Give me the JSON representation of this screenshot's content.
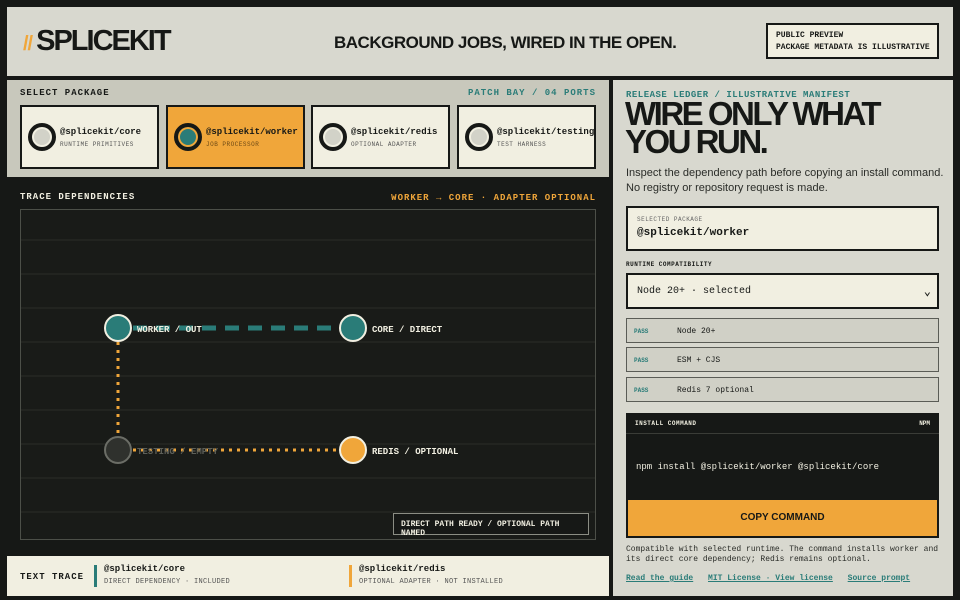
{
  "header": {
    "logo_slash": "//",
    "logo_text": "SPLICEKIT",
    "tagline": "BACKGROUND JOBS, WIRED IN THE OPEN.",
    "preview_line1": "PUBLIC PREVIEW",
    "preview_line2": "PACKAGE METADATA IS ILLUSTRATIVE"
  },
  "packages": {
    "label": "SELECT PACKAGE",
    "patch_label": "PATCH BAY / 04 PORTS",
    "items": [
      {
        "name": "@splicekit/core",
        "desc": "RUNTIME PRIMITIVES",
        "selected": false
      },
      {
        "name": "@splicekit/worker",
        "desc": "JOB PROCESSOR",
        "selected": true
      },
      {
        "name": "@splicekit/redis",
        "desc": "OPTIONAL ADAPTER",
        "selected": false
      },
      {
        "name": "@splicekit/testing",
        "desc": "TEST HARNESS",
        "selected": false
      }
    ]
  },
  "trace": {
    "title": "TRACE DEPENDENCIES",
    "path": "WORKER → CORE · ADAPTER OPTIONAL",
    "nodes": {
      "worker": "WORKER / OUT",
      "core": "CORE / DIRECT",
      "testing": "TESTING / EMPTY",
      "redis": "REDIS / OPTIONAL"
    },
    "status": "DIRECT PATH READY / OPTIONAL PATH NAMED"
  },
  "text_trace": {
    "label": "TEXT TRACE",
    "entries": [
      {
        "name": "@splicekit/core",
        "detail": "DIRECT DEPENDENCY · INCLUDED",
        "color": "#2a7c78"
      },
      {
        "name": "@splicekit/redis",
        "detail": "OPTIONAL ADAPTER · NOT INSTALLED",
        "color": "#f0a63a"
      }
    ]
  },
  "ledger": {
    "eyebrow": "RELEASE LEDGER / ILLUSTRATIVE MANIFEST",
    "headline": "WIRE ONLY WHAT YOU RUN.",
    "intro": "Inspect the dependency path before copying an install command. No registry or repository request is made.",
    "selected_label": "SELECTED PACKAGE",
    "selected_value": "@splicekit/worker",
    "runtime_label": "RUNTIME COMPATIBILITY",
    "runtime_value": "Node 20+ · selected",
    "checks": [
      {
        "status": "PASS",
        "text": "Node 20+"
      },
      {
        "status": "PASS",
        "text": "ESM + CJS"
      },
      {
        "status": "PASS",
        "text": "Redis 7 optional"
      }
    ],
    "install_title": "INSTALL COMMAND",
    "install_tool": "NPM",
    "install_cmd": "npm install @splicekit/worker @splicekit/core",
    "copy_label": "COPY COMMAND",
    "note": "Compatible with selected runtime. The command installs worker and its direct core dependency; Redis remains optional.",
    "links": [
      "Read the guide",
      "MIT License · View license",
      "Source prompt"
    ]
  },
  "colors": {
    "accent_orange": "#f0a63a",
    "accent_teal": "#2a7c78",
    "ink": "#161816",
    "paper": "#f1efe1"
  }
}
